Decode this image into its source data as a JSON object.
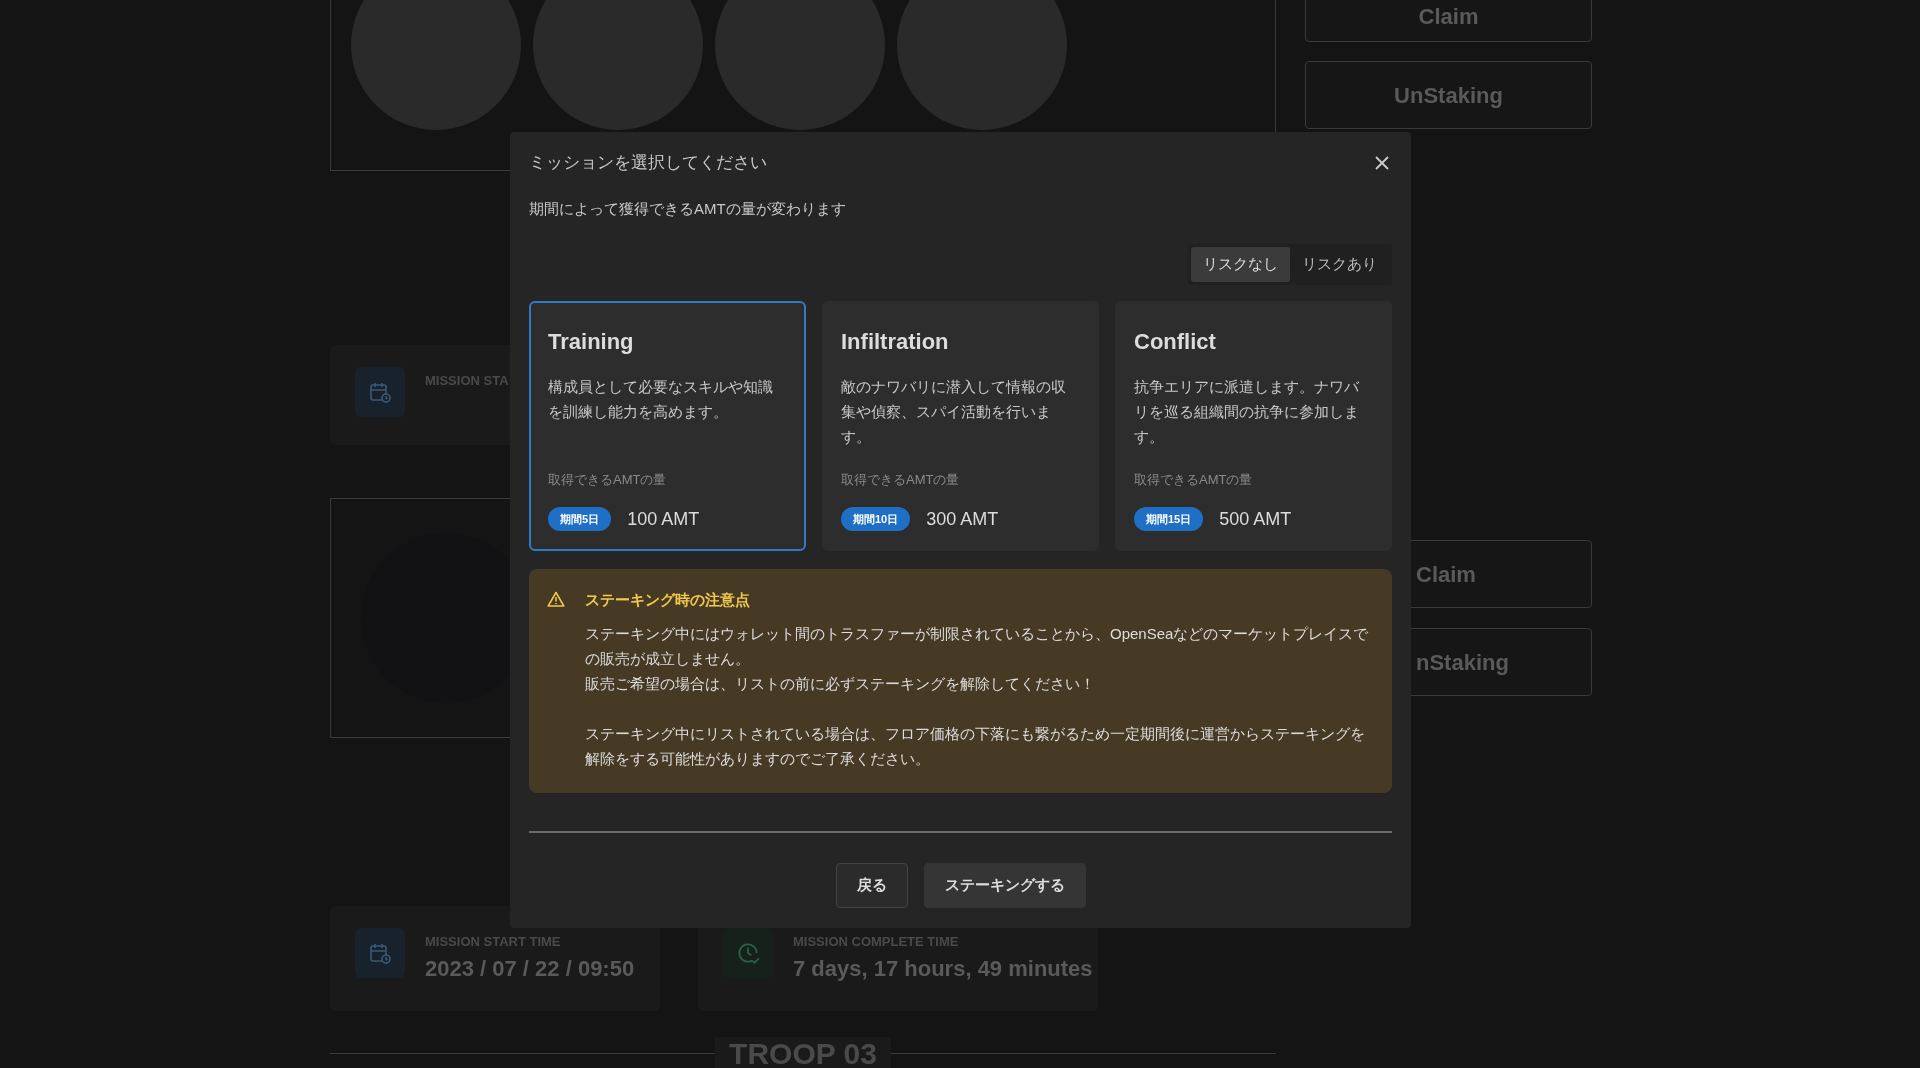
{
  "background": {
    "top_buttons": [
      "Claim",
      "UnStaking"
    ],
    "mission_panel": {
      "label": "MISSION STA"
    },
    "side_buttons": [
      "Claim",
      "nStaking"
    ],
    "info_cards": [
      {
        "kind": "calendar",
        "label": "MISSION START TIME",
        "value": "2023 / 07 / 22 / 09:50"
      },
      {
        "kind": "clock",
        "label": "MISSION COMPLETE TIME",
        "value": "7 days, 17 hours, 49 minutes"
      }
    ],
    "section_title": "TROOP 03"
  },
  "modal": {
    "title": "ミッションを選択してください",
    "subtitle": "期間によって獲得できるAMTの量が変わります",
    "risk_tabs": [
      {
        "label": "リスクなし",
        "selected": true
      },
      {
        "label": "リスクあり",
        "selected": false
      }
    ],
    "missions": [
      {
        "name": "Training",
        "description": "構成員として必要なスキルや知識を訓練し能力を高めます。",
        "amount_label": "取得できるAMTの量",
        "period": "期間5日",
        "amount": "100 AMT",
        "selected": true
      },
      {
        "name": "Infiltration",
        "description": "敵のナワバリに潜入して情報の収集や偵察、スパイ活動を行います。",
        "amount_label": "取得できるAMTの量",
        "period": "期間10日",
        "amount": "300 AMT",
        "selected": false
      },
      {
        "name": "Conflict",
        "description": "抗争エリアに派遣します。ナワバリを巡る組織間の抗争に参加します。",
        "amount_label": "取得できるAMTの量",
        "period": "期間15日",
        "amount": "500 AMT",
        "selected": false
      }
    ],
    "notice": {
      "title": "ステーキング時の注意点",
      "paragraphs": [
        {
          "lines": [
            "ステーキング中にはウォレット間のトラスファーが制限されていることから、OpenSeaなどのマーケットプレイスでの販売が成立しません。",
            "販売ご希望の場合は、リストの前に必ずステーキングを解除してください！"
          ]
        },
        {
          "lines": [
            "ステーキング中にリストされている場合は、フロア価格の下落にも繋がるため一定期間後に運営からステーキングを解除をする可能性がありますのでご了承ください。"
          ]
        }
      ]
    },
    "buttons": [
      {
        "label": "戻る",
        "kind": "secondary"
      },
      {
        "label": "ステーキングする",
        "kind": "primary"
      }
    ]
  }
}
